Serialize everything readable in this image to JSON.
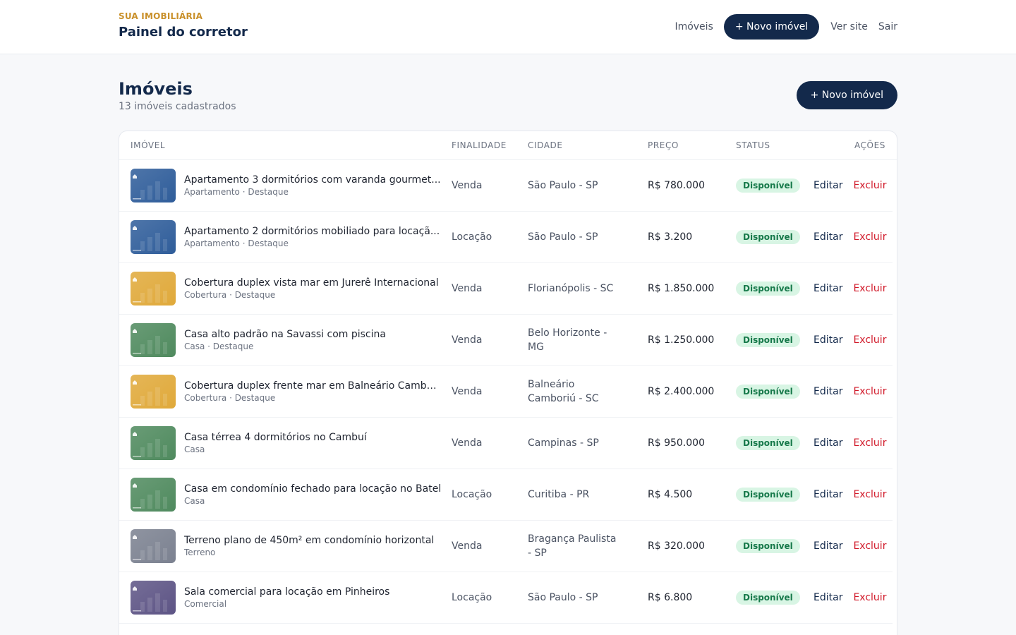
{
  "brand": {
    "small": "SUA IMOBILIÁRIA",
    "title": "Painel do corretor"
  },
  "nav": {
    "imoveis": "Imóveis",
    "novo": "+ Novo imóvel",
    "ver_site": "Ver site",
    "sair": "Sair"
  },
  "page": {
    "title": "Imóveis",
    "subtitle": "13 imóveis cadastrados",
    "novo": "+ Novo imóvel"
  },
  "table": {
    "headers": {
      "imovel": "IMÓVEL",
      "finalidade": "FINALIDADE",
      "cidade": "CIDADE",
      "preco": "PREÇO",
      "status": "STATUS",
      "acoes": "AÇÕES"
    },
    "edit_label": "Editar",
    "delete_label": "Excluir",
    "rows": [
      {
        "title": "Apartamento 3 dormitórios com varanda gourmet...",
        "meta": "Apartamento · Destaque",
        "finalidade": "Venda",
        "cidade": "São Paulo - SP",
        "preco": "R$ 780.000",
        "status": "Disponível",
        "thumb": "blue"
      },
      {
        "title": "Apartamento 2 dormitórios mobiliado para locaçã...",
        "meta": "Apartamento · Destaque",
        "finalidade": "Locação",
        "cidade": "São Paulo - SP",
        "preco": "R$ 3.200",
        "status": "Disponível",
        "thumb": "blue"
      },
      {
        "title": "Cobertura duplex vista mar em Jurerê Internacional",
        "meta": "Cobertura · Destaque",
        "finalidade": "Venda",
        "cidade": "Florianópolis - SC",
        "preco": "R$ 1.850.000",
        "status": "Disponível",
        "thumb": "gold"
      },
      {
        "title": "Casa alto padrão na Savassi com piscina",
        "meta": "Casa · Destaque",
        "finalidade": "Venda",
        "cidade": "Belo Horizonte - MG",
        "preco": "R$ 1.250.000",
        "status": "Disponível",
        "thumb": "green"
      },
      {
        "title": "Cobertura duplex frente mar em Balneário Camboriú",
        "meta": "Cobertura · Destaque",
        "finalidade": "Venda",
        "cidade": "Balneário Camboriú - SC",
        "preco": "R$ 2.400.000",
        "status": "Disponível",
        "thumb": "gold"
      },
      {
        "title": "Casa térrea 4 dormitórios no Cambuí",
        "meta": "Casa",
        "finalidade": "Venda",
        "cidade": "Campinas - SP",
        "preco": "R$ 950.000",
        "status": "Disponível",
        "thumb": "green"
      },
      {
        "title": "Casa em condomínio fechado para locação no Batel",
        "meta": "Casa",
        "finalidade": "Locação",
        "cidade": "Curitiba - PR",
        "preco": "R$ 4.500",
        "status": "Disponível",
        "thumb": "green"
      },
      {
        "title": "Terreno plano de 450m² em condomínio horizontal",
        "meta": "Terreno",
        "finalidade": "Venda",
        "cidade": "Bragança Paulista - SP",
        "preco": "R$ 320.000",
        "status": "Disponível",
        "thumb": "gray"
      },
      {
        "title": "Sala comercial para locação em Pinheiros",
        "meta": "Comercial",
        "finalidade": "Locação",
        "cidade": "São Paulo - SP",
        "preco": "R$ 6.800",
        "status": "Disponível",
        "thumb": "purple"
      }
    ]
  },
  "colors": {
    "primary": "#13294b",
    "brand_accent": "#c9902a",
    "delete": "#d11a2a",
    "badge_bg": "#d8f5e4",
    "badge_text": "#16794a",
    "thumbs": {
      "blue": "#2f5d9a",
      "gold": "#e0a93a",
      "green": "#4f8a5e",
      "gray": "#7b8190",
      "purple": "#5d5485"
    }
  }
}
